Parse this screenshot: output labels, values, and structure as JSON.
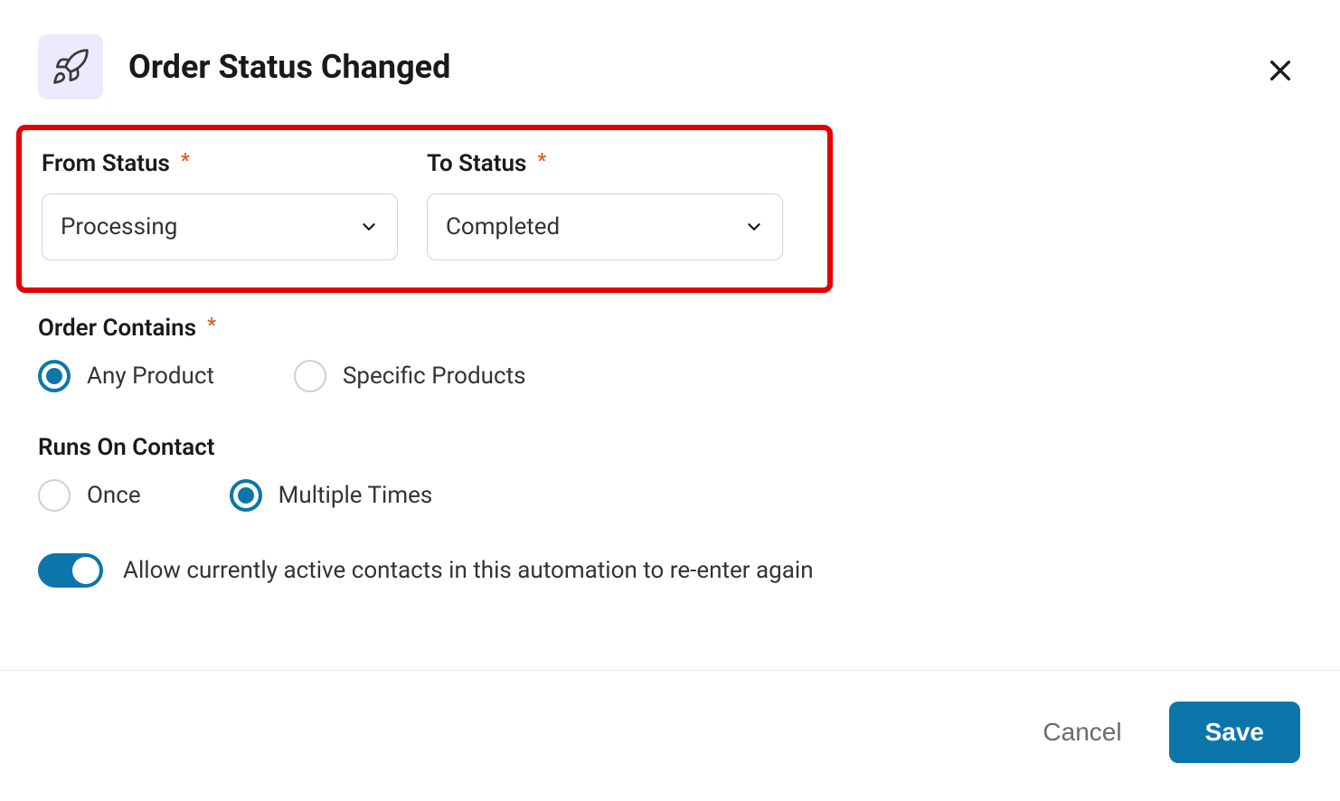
{
  "header": {
    "title": "Order Status Changed"
  },
  "fields": {
    "from_status": {
      "label": "From Status",
      "value": "Processing"
    },
    "to_status": {
      "label": "To Status",
      "value": "Completed"
    }
  },
  "order_contains": {
    "label": "Order Contains",
    "options": {
      "any": "Any Product",
      "specific": "Specific Products"
    },
    "selected": "any"
  },
  "runs_on_contact": {
    "label": "Runs On Contact",
    "options": {
      "once": "Once",
      "multiple": "Multiple Times"
    },
    "selected": "multiple"
  },
  "reenter": {
    "label": "Allow currently active contacts in this automation to re-enter again",
    "enabled": true
  },
  "footer": {
    "cancel": "Cancel",
    "save": "Save"
  }
}
